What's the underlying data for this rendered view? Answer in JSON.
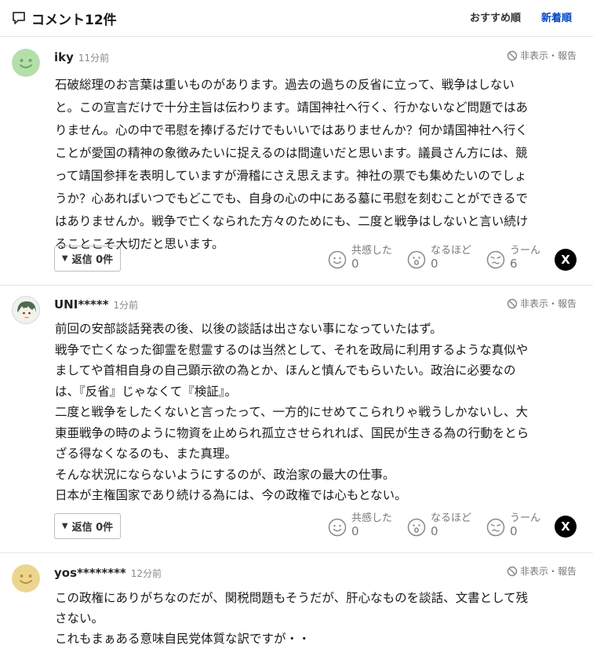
{
  "header": {
    "title": "コメント12件",
    "sort_recommended": "おすすめ順",
    "sort_newest": "新着順"
  },
  "labels": {
    "report": "非表示・報告",
    "reply": "返信 0件",
    "react1": "共感した",
    "react2": "なるほど",
    "react3": "うーん",
    "share": "X"
  },
  "comments": [
    {
      "user": "iky",
      "time": "11分前",
      "lines": [
        "石破総理のお言葉は重いものがあります。過去の過ちの反省に立って、戦争はしない",
        "と。この宣言だけで十分主旨は伝わります。靖国神社へ行く、行かないなど問題ではあ",
        "りません。心の中で弔慰を捧げるだけでもいいではありませんか？何か靖国神社へ行く",
        "ことが愛国の精神の象徴みたいに捉えるのは間違いだと思います。議員さん方には、競",
        "って靖国参拝を表明していますが滑稽にさえ思えます。神社の票でも集めたいのでしょ",
        "うか？心あればいつでもどこでも、自身の心の中にある墓に弔慰を刻むことができるで",
        "はありませんか。戦争で亡くなられた方々のためにも、二度と戦争はしないと言い続け",
        "ることこそ大切だと思います。"
      ],
      "counts": [
        "0",
        "0",
        "6"
      ]
    },
    {
      "user": "UNI*****",
      "time": "1分前",
      "lines": [
        "前回の安部談話発表の後、以後の談話は出さない事になっていたはず。",
        "戦争で亡くなった御霊を慰霊するのは当然として、それを政局に利用するような真似や",
        "ましてや首相自身の自己顕示欲の為とか、ほんと慎んでもらいたい。政治に必要なの",
        "は、『反省』じゃなくて『検証』。",
        "二度と戦争をしたくないと言ったって、一方的にせめてこられりゃ戦うしかないし、大",
        "東亜戦争の時のように物資を止められ孤立させられれば、国民が生きる為の行動をとら",
        "ざる得なくなるのも、また真理。",
        "そんな状況にならないようにするのが、政治家の最大の仕事。",
        "日本が主権国家であり続ける為には、今の政権では心もとない。"
      ],
      "counts": [
        "0",
        "0",
        "0"
      ]
    },
    {
      "user": "yos********",
      "time": "12分前",
      "lines": [
        "この政権にありがちなのだが、関税問題もそうだが、肝心なものを談話、文書として残",
        "さない。",
        "これもまぁある意味自民党体質な訳ですが・・"
      ]
    }
  ],
  "colors": {
    "accent": "#0046c7",
    "avatar_face": "#b5dfa8",
    "avatar_face3": "#ecd58f"
  }
}
